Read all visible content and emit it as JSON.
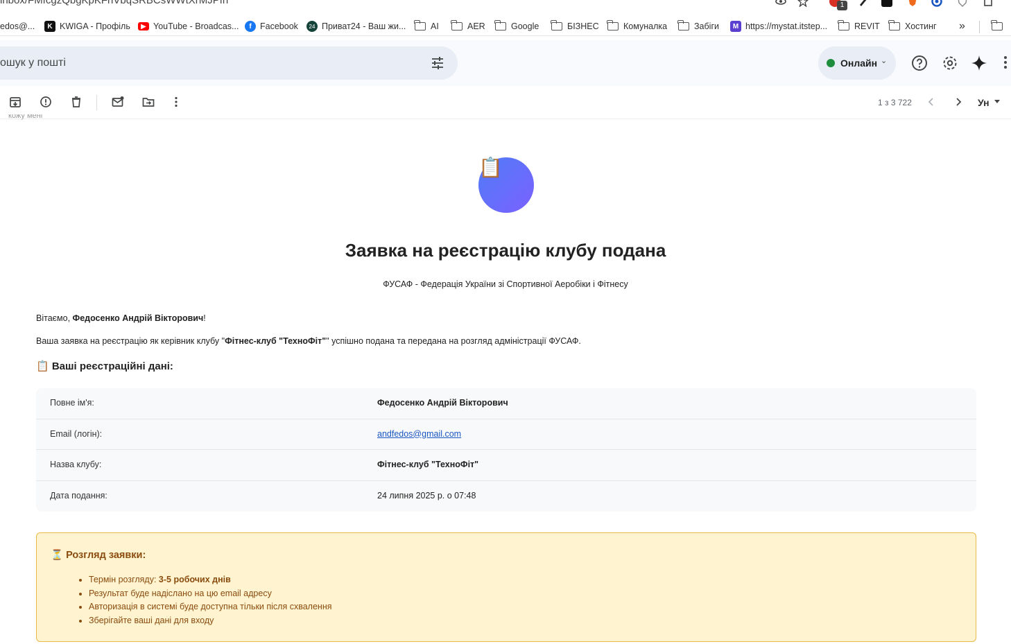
{
  "browser": {
    "url_fragment": "inbox/FMfcgzQbgKpKFhVbqSRBCsWWtXrMJPfn",
    "extension_badge": "1",
    "bookmarks": [
      {
        "label": "edos@...",
        "icon": "none"
      },
      {
        "label": "KWIGA - Профіль",
        "icon": "kwiga-icon"
      },
      {
        "label": "YouTube - Broadcas...",
        "icon": "youtube-icon"
      },
      {
        "label": "Facebook",
        "icon": "facebook-icon"
      },
      {
        "label": "Приват24 - Ваш жи...",
        "icon": "privat24-icon"
      },
      {
        "label": "AI",
        "icon": "folder-icon"
      },
      {
        "label": "AER",
        "icon": "folder-icon"
      },
      {
        "label": "Google",
        "icon": "folder-icon"
      },
      {
        "label": "БІЗНЕС",
        "icon": "folder-icon"
      },
      {
        "label": "Комуналка",
        "icon": "folder-icon"
      },
      {
        "label": "Забіги",
        "icon": "folder-icon"
      },
      {
        "label": "https://mystat.itstep...",
        "icon": "mystat-icon"
      },
      {
        "label": "REVIT",
        "icon": "folder-icon"
      },
      {
        "label": "Хостинг",
        "icon": "folder-icon"
      }
    ],
    "overflow_label": "»"
  },
  "gmail": {
    "search_placeholder": "ошук у пошті",
    "status_label": "Онлайн",
    "pager": "1 з 3 722",
    "lang_label": "Ун",
    "cut_text": "кожу мені"
  },
  "email": {
    "logo_emoji": "📋",
    "title": "Заявка на реєстрацію клубу подана",
    "subtitle": "ФУСАФ - Федерація України зі Спортивної Аеробіки і Фітнесу",
    "greeting_prefix": "Вітаємо, ",
    "greeting_name": "Федосенко Андрій Вікторович",
    "greeting_suffix": "!",
    "intro_prefix": "Ваша заявка на реєстрацію як керівник клубу \"",
    "intro_club": "Фітнес-клуб \"ТехноФіт\"",
    "intro_suffix": "\" успішно подана та передана на розгляд адміністрації ФУСАФ.",
    "section_heading": "📋 Ваші реєстраційні дані:",
    "rows": [
      {
        "label": "Повне ім'я:",
        "value": "Федосенко Андрій Вікторович"
      },
      {
        "label": "Email (логін):",
        "value": "andfedos@gmail.com"
      },
      {
        "label": "Назва клубу:",
        "value": "Фітнес-клуб \"ТехноФіт\""
      },
      {
        "label": "Дата подання:",
        "value": "24 липня 2025 р. о 07:48"
      }
    ],
    "notice": {
      "heading": "⏳ Розгляд заявки:",
      "item1_prefix": "Термін розгляду: ",
      "item1_bold": "3-5 робочих днів",
      "item2": "Результат буде надіслано на цю email адресу",
      "item3": "Авторизація в системі буде доступна тільки після схвалення",
      "item4": "Зберігайте ваші дані для входу"
    }
  },
  "colors": {
    "accent_blue": "#4f7cf7",
    "accent_purple": "#7b61ff",
    "link": "#1a56c2",
    "notice_bg": "#fff4cf",
    "notice_border": "#e9b949",
    "notice_text": "#8a4b0f",
    "online": "#1e8e3e"
  }
}
